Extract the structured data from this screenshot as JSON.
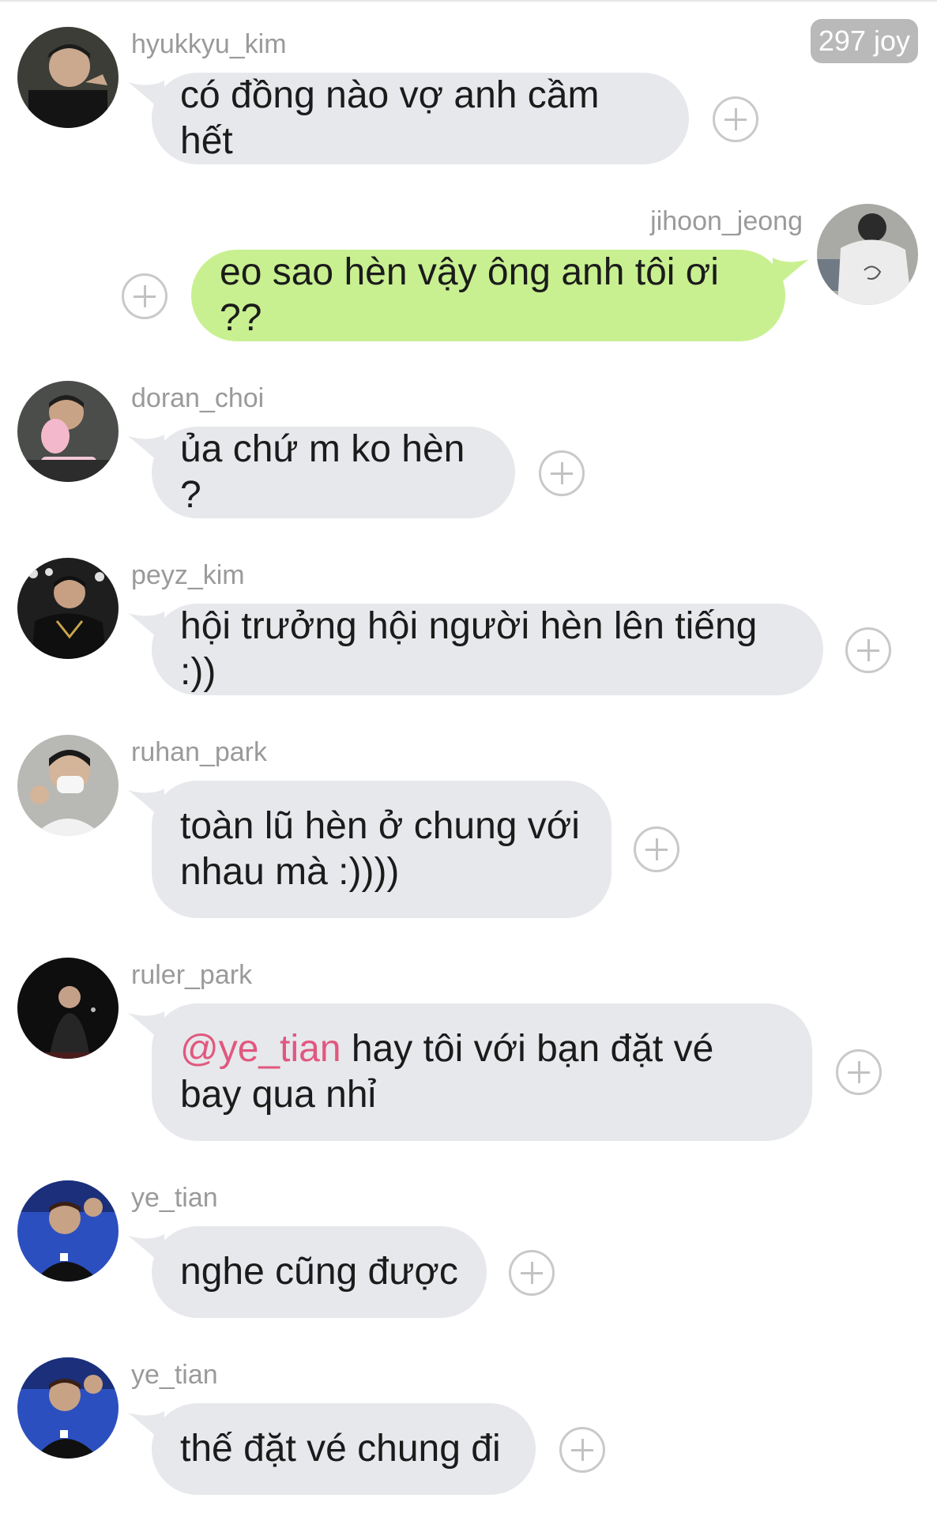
{
  "badge": "297 joy",
  "messages": [
    {
      "user": "hyukkyu_kim",
      "text": "có đồng nào vợ anh cầm hết",
      "side": "left",
      "avatar": "avatar-dark-hoodie"
    },
    {
      "user": "jihoon_jeong",
      "text": "eo sao hèn vậy ông anh tôi ơi ??",
      "side": "right",
      "avatar": "avatar-white-shirt"
    },
    {
      "user": "doran_choi",
      "text": "ủa chứ m ko hèn ?",
      "side": "left",
      "avatar": "avatar-birthday-cake"
    },
    {
      "user": "peyz_kim",
      "text": "hội trưởng hội người hèn lên tiếng :))",
      "side": "left",
      "avatar": "avatar-black-jersey"
    },
    {
      "user": "ruhan_park",
      "text": "toàn lũ hèn ở chung với nhau mà :))))",
      "side": "left",
      "avatar": "avatar-white-mask"
    },
    {
      "user": "ruler_park",
      "mention": "@ye_tian",
      "text": " hay tôi với bạn đặt vé bay qua nhỉ",
      "side": "left",
      "avatar": "avatar-stage-dark"
    },
    {
      "user": "ye_tian",
      "text": "nghe cũng được",
      "side": "left",
      "avatar": "avatar-waving-blue"
    },
    {
      "user": "ye_tian",
      "text": "thế đặt vé chung đi",
      "side": "left",
      "avatar": "avatar-waving-blue"
    }
  ],
  "colors": {
    "bubble_gray": "#e7e8eb",
    "bubble_green": "#c8f090",
    "mention": "#e0587f",
    "username": "#9a9a9a"
  },
  "icons": {
    "add_reaction": "plus-circle-icon"
  }
}
